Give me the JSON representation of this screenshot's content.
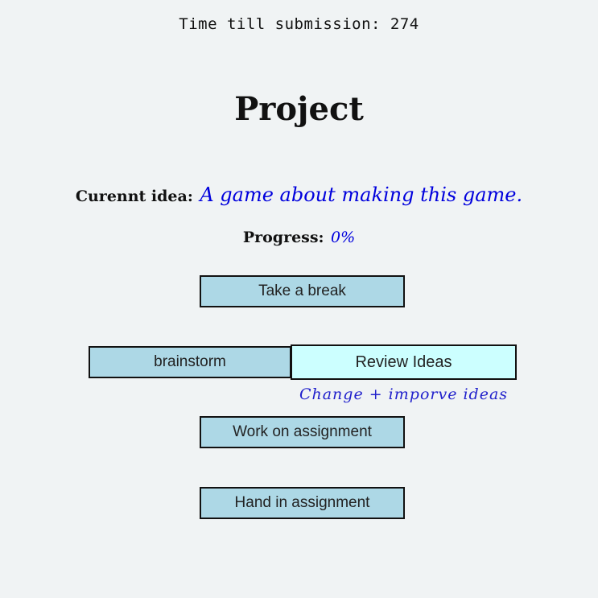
{
  "header": {
    "timer_label": "Time till submission:",
    "timer_value": "274"
  },
  "title": "Project",
  "idea": {
    "label": "Curennt idea:",
    "value": "A game about making this game."
  },
  "progress": {
    "label": "Progress:",
    "value": "0%"
  },
  "buttons": {
    "take_break": "Take a break",
    "brainstorm": "brainstorm",
    "review_ideas": "Review Ideas",
    "work_on_assignment": "Work on assignment",
    "hand_in_assignment": "Hand in assignment"
  },
  "tooltip": {
    "review_ideas": "Change + imporve ideas"
  },
  "colors": {
    "background": "#f0f3f4",
    "button": "#add8e6",
    "button_hover": "#ccffff",
    "handwriting": "#0000dd"
  }
}
